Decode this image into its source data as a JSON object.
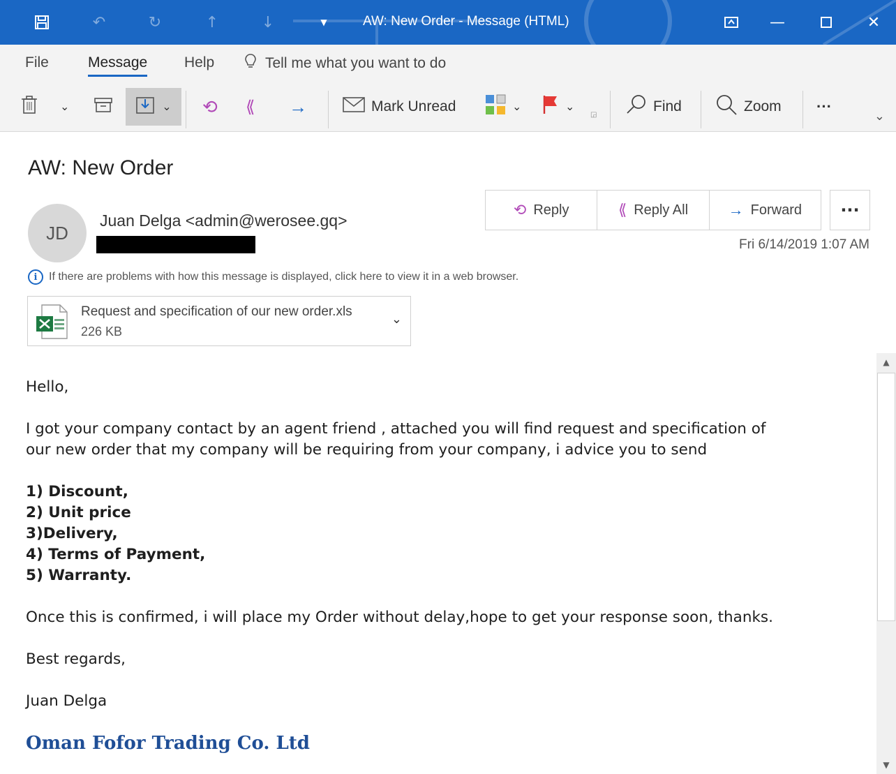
{
  "window": {
    "title": "AW: New Order  -  Message (HTML)"
  },
  "menu": {
    "file": "File",
    "message": "Message",
    "help": "Help",
    "tell_me": "Tell me what you want to do"
  },
  "toolbar": {
    "mark_unread": "Mark Unread",
    "find": "Find",
    "zoom": "Zoom",
    "more": "···"
  },
  "message": {
    "subject": "AW: New Order",
    "avatar_initials": "JD",
    "sender": "Juan Delga <admin@werosee.gq>",
    "date": "Fri 6/14/2019 1:07 AM",
    "info": "If there are problems with how this message is displayed, click here to view it in a web browser.",
    "actions": {
      "reply": "Reply",
      "reply_all": "Reply All",
      "forward": "Forward",
      "more": "···"
    },
    "attachment": {
      "name": "Request and specification of our new order.xls",
      "size": "226 KB"
    }
  },
  "body": {
    "greeting": "Hello,",
    "para1_line1": "I got your company contact by an agent friend , attached you will find request and specification of",
    "para1_line2": "our new order that my company will be requiring from your company, i advice you to send",
    "list": [
      "1) Discount,",
      "2) Unit price",
      "3)Delivery,",
      "4) Terms of Payment,",
      "5) Warranty."
    ],
    "para2": "Once this is confirmed, i will place my Order without delay,hope to get your response soon, thanks.",
    "closing": "Best regards,",
    "signature": "Juan Delga",
    "company": "Oman Fofor Trading Co. Ltd"
  },
  "colors": {
    "titlebar": "#1a67c4",
    "accent": "#1a67c4",
    "company": "#1f4e96"
  }
}
